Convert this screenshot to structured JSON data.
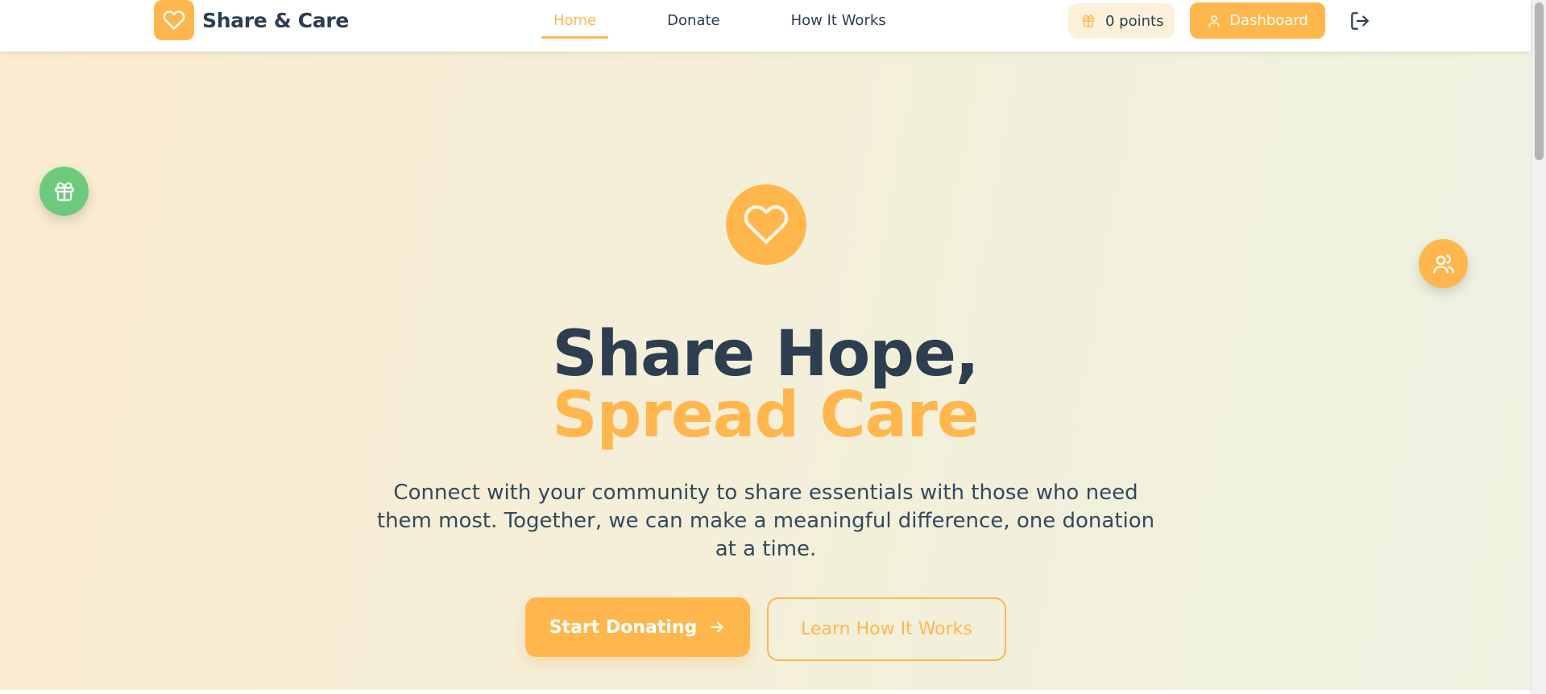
{
  "brand": {
    "name": "Share & Care",
    "logo_icon": "heart-icon"
  },
  "nav": {
    "links": [
      {
        "label": "Home",
        "active": true
      },
      {
        "label": "Donate",
        "active": false
      },
      {
        "label": "How It Works",
        "active": false
      }
    ]
  },
  "header": {
    "points_label": "0 points",
    "points_icon": "gift-icon",
    "dashboard_label": "Dashboard",
    "dashboard_icon": "user-icon",
    "logout_icon": "logout-icon"
  },
  "hero": {
    "icon": "heart-icon",
    "title_line1": "Share Hope,",
    "title_line2": "Spread Care",
    "subtitle": "Connect with your community to share essentials with those who need them most. Together, we can make a meaningful difference, one donation at a time.",
    "primary_button": "Start Donating",
    "secondary_button": "Learn How It Works"
  },
  "floating": {
    "left_icon": "gift-icon",
    "right_icon": "users-icon"
  },
  "colors": {
    "accent": "#ffb74d",
    "text_dark": "#2c3e50",
    "green": "#6ccb7b",
    "points_bg": "#fdf1dc"
  }
}
